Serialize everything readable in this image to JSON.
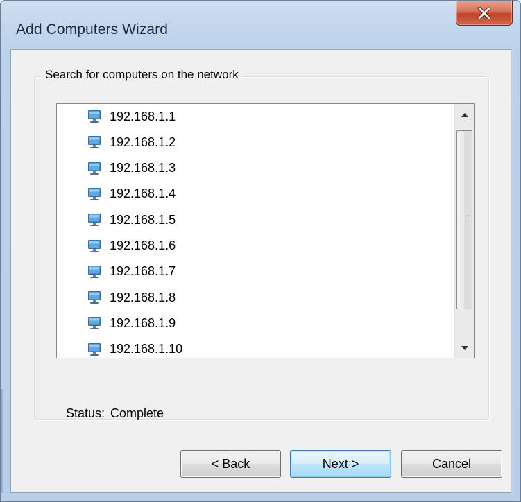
{
  "window": {
    "title": "Add Computers Wizard"
  },
  "titlebar": {
    "close_icon": "close-x-icon"
  },
  "search_group": {
    "label": "Search for computers on the network",
    "computer_icon": "monitor-computer-icon",
    "computers": [
      "192.168.1.1",
      "192.168.1.2",
      "192.168.1.3",
      "192.168.1.4",
      "192.168.1.5",
      "192.168.1.6",
      "192.168.1.7",
      "192.168.1.8",
      "192.168.1.9",
      "192.168.1.10"
    ],
    "status_label": "Status:",
    "status_value": "Complete"
  },
  "buttons": {
    "back": "< Back",
    "next": "Next >",
    "cancel": "Cancel"
  },
  "colors": {
    "close_button": "#c7492f",
    "default_button_border": "#3c7fb1",
    "dialog_background": "#f0f0f0"
  }
}
